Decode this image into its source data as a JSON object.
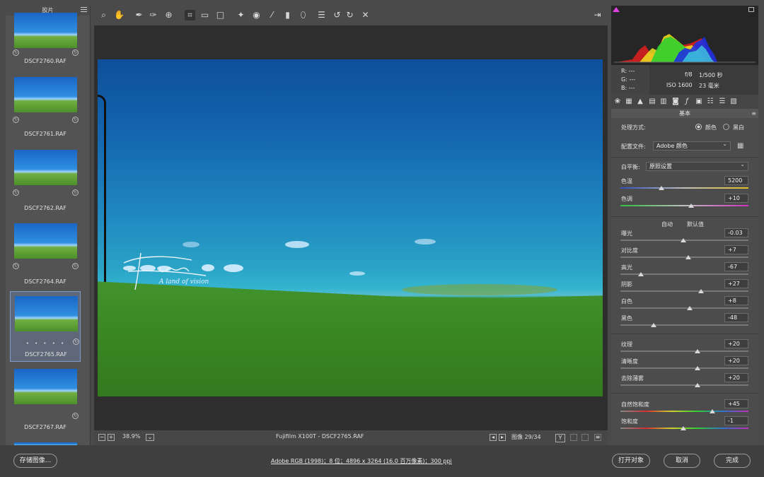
{
  "filmstrip": {
    "title": "胶片",
    "thumbnails": [
      {
        "name": "DSCF2760.RAF",
        "selected": false
      },
      {
        "name": "DSCF2761.RAF",
        "selected": false
      },
      {
        "name": "DSCF2762.RAF",
        "selected": false
      },
      {
        "name": "DSCF2764.RAF",
        "selected": false
      },
      {
        "name": "DSCF2765.RAF",
        "selected": true,
        "rating_dots": "• • • • •"
      },
      {
        "name": "DSCF2767.RAF",
        "selected": false
      }
    ]
  },
  "toolbar": {
    "tools": [
      "zoom-icon",
      "hand-icon",
      "white-balance-icon",
      "color-sampler-icon",
      "target-adjust-icon",
      "crop-icon",
      "straighten-icon",
      "transform-icon",
      "spot-removal-icon",
      "red-eye-icon",
      "adjustment-brush-icon",
      "graduated-filter-icon",
      "radial-filter-icon",
      "list-icon",
      "rotate-left-icon",
      "rotate-right-icon",
      "trash-icon"
    ],
    "export_icon": "open-export-icon"
  },
  "canvas": {
    "watermark_text": "A land of vision"
  },
  "canvas_footer": {
    "zoom": "38.9%",
    "filename": "Fujifilm X100T - DSCF2765.RAF",
    "image_counter": "图像 29/34",
    "y_button": "Y"
  },
  "meta": {
    "r": "R:  ---",
    "g": "G:  ---",
    "b": "B:  ---",
    "aperture": "f/8",
    "shutter": "1/500 秒",
    "iso": "ISO 1600",
    "focal": "23 毫米"
  },
  "panel": {
    "title": "基本",
    "treatment_label": "处理方式:",
    "treatment_color": "颜色",
    "treatment_bw": "黑白",
    "profile_label": "配置文件:",
    "profile_value": "Adobe 颜色",
    "wb_label": "白平衡:",
    "wb_value": "原照设置",
    "auto_label": "自动",
    "default_label": "默认值",
    "sliders": [
      {
        "label": "色温",
        "value": "5200",
        "pos": 0.32
      },
      {
        "label": "色调",
        "value": "+10",
        "pos": 0.55
      },
      {
        "label": "曝光",
        "value": "-0.03",
        "pos": 0.49
      },
      {
        "label": "对比度",
        "value": "+7",
        "pos": 0.53
      },
      {
        "label": "高光",
        "value": "-67",
        "pos": 0.16
      },
      {
        "label": "阴影",
        "value": "+27",
        "pos": 0.63
      },
      {
        "label": "白色",
        "value": "+8",
        "pos": 0.54
      },
      {
        "label": "黑色",
        "value": "-48",
        "pos": 0.26
      },
      {
        "label": "纹理",
        "value": "+20",
        "pos": 0.6
      },
      {
        "label": "清晰度",
        "value": "+20",
        "pos": 0.6
      },
      {
        "label": "去除薄雾",
        "value": "+20",
        "pos": 0.6
      },
      {
        "label": "自然饱和度",
        "value": "+45",
        "pos": 0.72
      },
      {
        "label": "饱和度",
        "value": "-1",
        "pos": 0.49
      }
    ]
  },
  "bottom": {
    "save_label": "存储图像...",
    "info": "Adobe RGB (1998)；8 位；4896 x 3264 (16.0 百万像素)；300 ppi",
    "open_label": "打开对象",
    "cancel_label": "取消",
    "done_label": "完成"
  }
}
